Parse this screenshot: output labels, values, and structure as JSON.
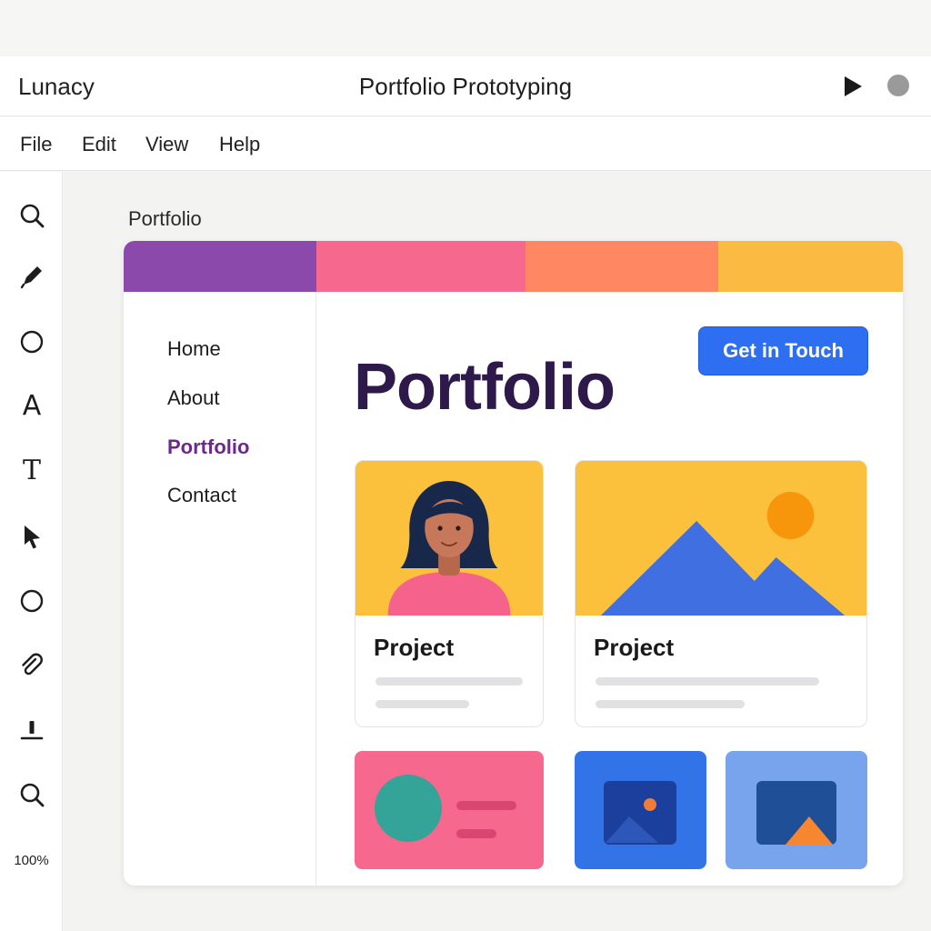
{
  "app": {
    "name": "Lunacy",
    "document_title": "Portfolio Prototyping"
  },
  "titlebar": {
    "play_icon": "play-icon",
    "record_icon": "record-dot-icon"
  },
  "menu": [
    "File",
    "Edit",
    "View",
    "Help"
  ],
  "toolbar": {
    "tools": [
      "search-icon",
      "pen-icon",
      "ellipse-icon",
      "text-a-icon",
      "text-t-icon",
      "pointer-icon",
      "circle-icon",
      "paperclip-icon",
      "upload-icon",
      "zoom-icon"
    ],
    "text_a": "A",
    "text_t": "T",
    "zoom": "100%"
  },
  "canvas": {
    "frame_label": "Portfolio"
  },
  "artboard": {
    "colors": [
      "#8b4aab",
      "#f7688f",
      "#ff8862",
      "#fbbb42"
    ],
    "nav": [
      "Home",
      "About",
      "Portfolio",
      "Contact"
    ],
    "active_nav": "Portfolio",
    "hero_title": "Portfolio",
    "cta_label": "Get in Touch",
    "cards": [
      {
        "title": "Project",
        "image": "person-avatar"
      },
      {
        "title": "Project",
        "image": "mountain-sun"
      }
    ],
    "tiles": [
      "profile-card-tile",
      "image-placeholder-tile",
      "image-placeholder-tile"
    ]
  }
}
